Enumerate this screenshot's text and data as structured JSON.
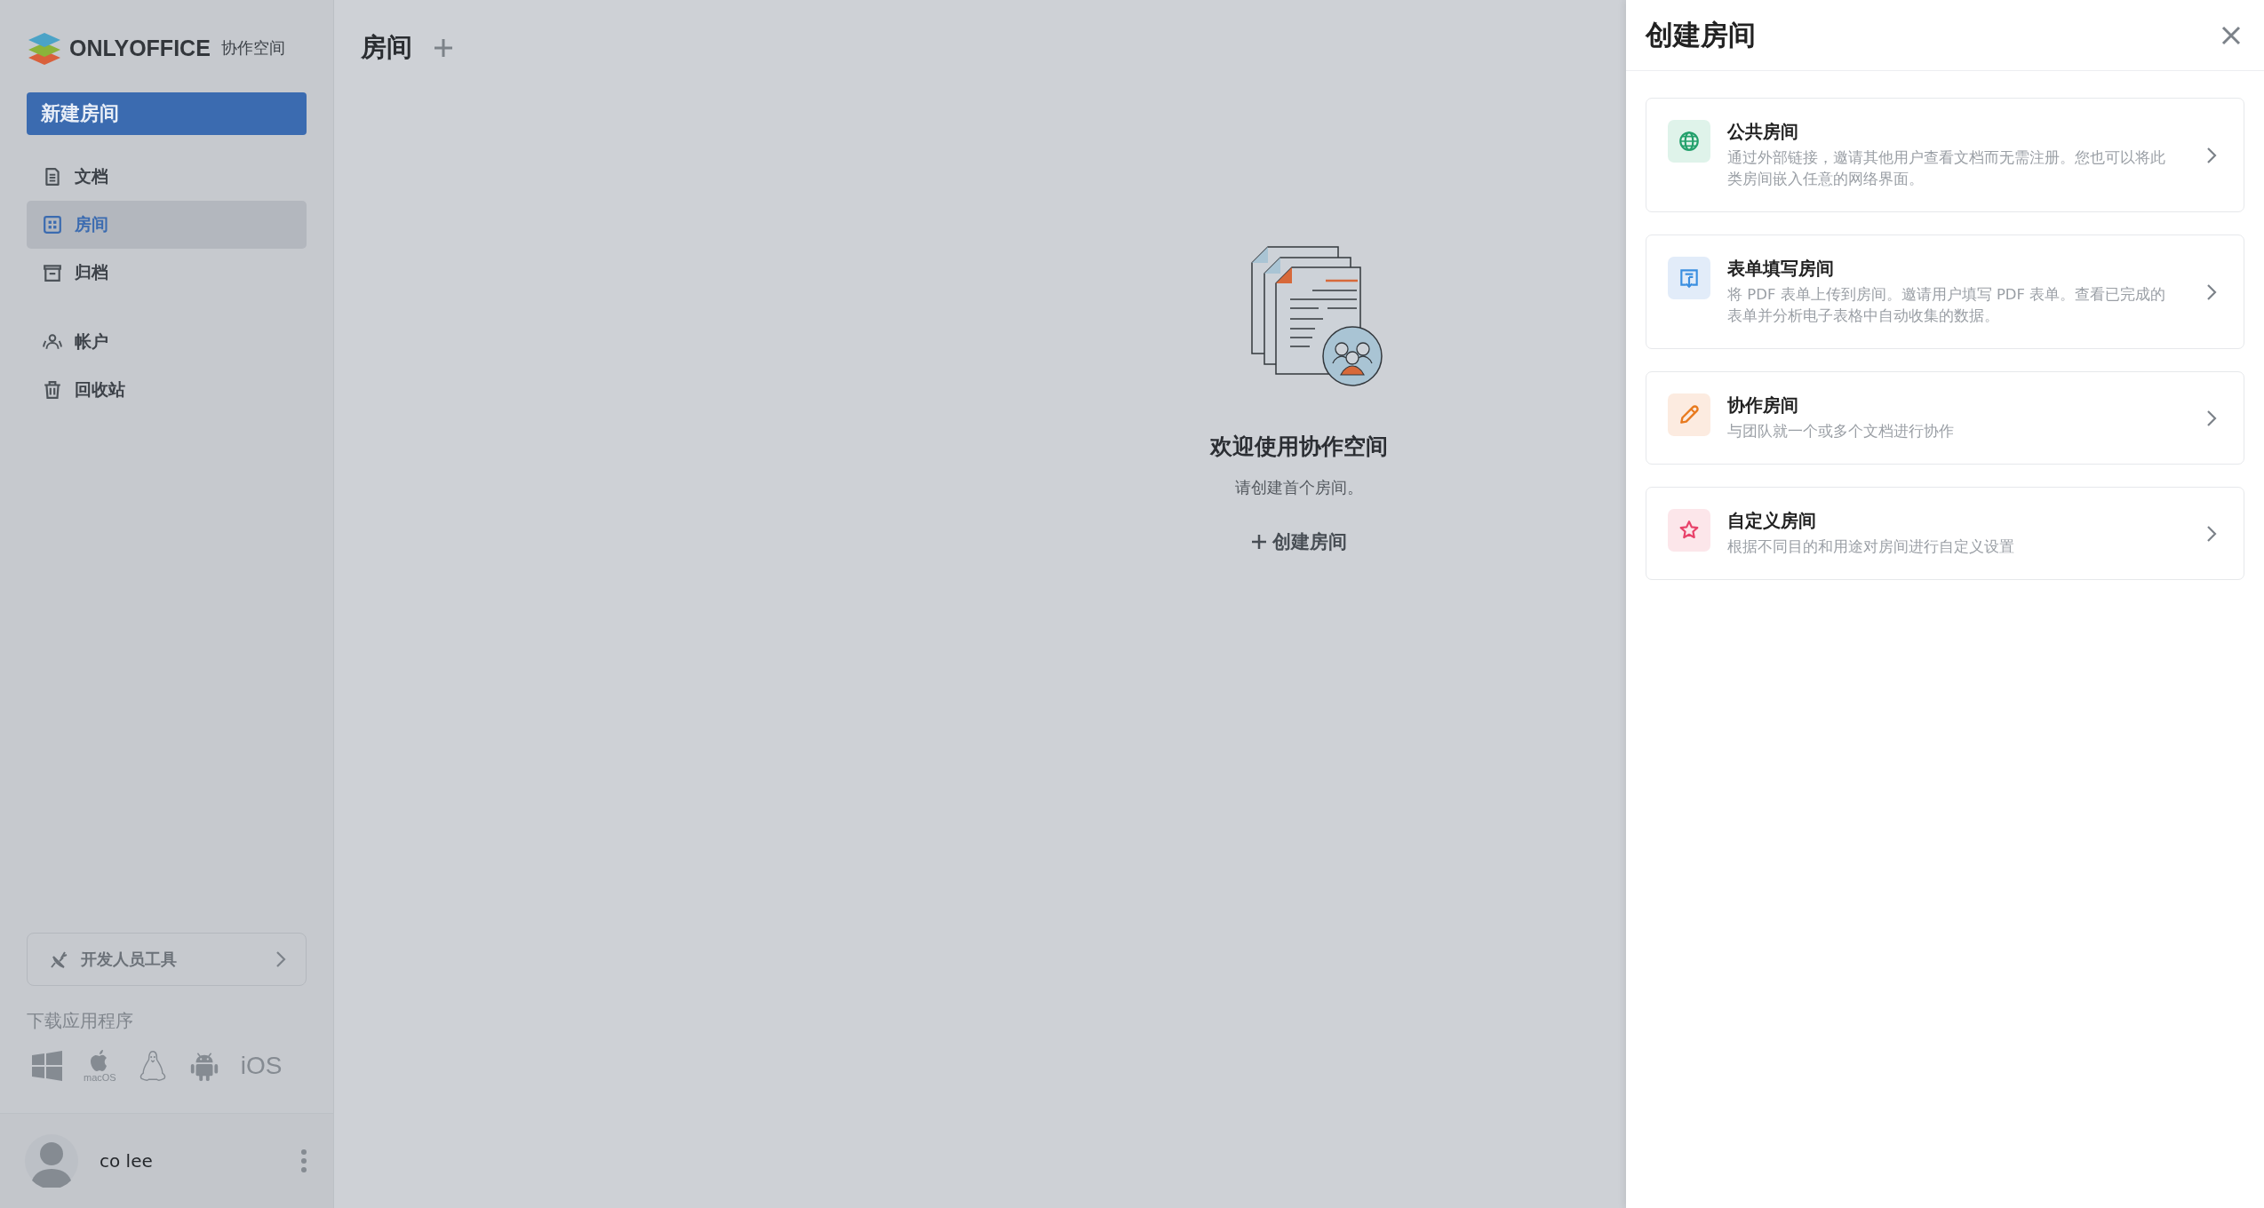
{
  "logo": {
    "brand": "ONLYOFFICE",
    "product": "协作空间"
  },
  "sidebar": {
    "new_button": "新建房间",
    "nav_groups": [
      {
        "items": [
          {
            "label": "文档",
            "kind": "document",
            "selected": false
          },
          {
            "label": "房间",
            "kind": "rooms",
            "selected": true
          },
          {
            "label": "归档",
            "kind": "archive",
            "selected": false
          }
        ]
      },
      {
        "items": [
          {
            "label": "帐户",
            "kind": "people",
            "selected": false
          },
          {
            "label": "回收站",
            "kind": "trash",
            "selected": false
          }
        ]
      }
    ],
    "developer_tools": "开发人员工具",
    "download": {
      "label": "下载应用程序",
      "platforms": [
        {
          "kind": "windows"
        },
        {
          "kind": "macos",
          "label": "macOS"
        },
        {
          "kind": "linux"
        },
        {
          "kind": "android"
        },
        {
          "kind": "ios",
          "label": "iOS"
        }
      ]
    },
    "user": {
      "name": "co lee"
    }
  },
  "main": {
    "title": "房间",
    "empty_state": {
      "title": "欢迎使用协作空间",
      "subtitle": "请创建首个房间。",
      "action": "创建房间"
    }
  },
  "panel": {
    "title": "创建房间",
    "room_types": [
      {
        "kind": "public",
        "title": "公共房间",
        "description": "通过外部链接，邀请其他用户查看文档而无需注册。您也可以将此类房间嵌入任意的网络界面。"
      },
      {
        "kind": "form",
        "title": "表单填写房间",
        "description": "将 PDF 表单上传到房间。邀请用户填写 PDF 表单。查看已完成的表单并分析电子表格中自动收集的数据。"
      },
      {
        "kind": "collaboration",
        "title": "协作房间",
        "description": "与团队就一个或多个文档进行协作"
      },
      {
        "kind": "custom",
        "title": "自定义房间",
        "description": "根据不同目的和用途对房间进行自定义设置"
      }
    ]
  }
}
